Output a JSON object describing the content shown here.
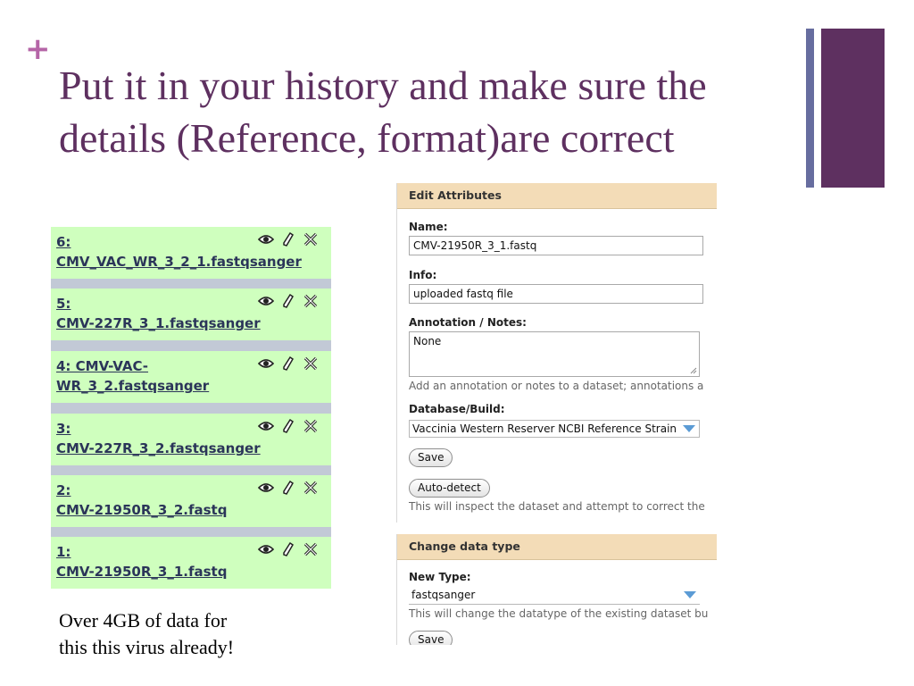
{
  "slide": {
    "plus": "+",
    "title": "Put it in your history and make sure the details (Reference, format)are correct",
    "note_line1": "Over 4GB of data for",
    "note_line2": "this this virus already!"
  },
  "history": {
    "items": [
      {
        "line1": "6:",
        "line2": "CMV_VAC_WR_3_2_1.fastqsanger"
      },
      {
        "line1": "5:",
        "line2": "CMV-227R_3_1.fastqsanger"
      },
      {
        "line1": "4: CMV-VAC-",
        "line2": "WR_3_2.fastqsanger"
      },
      {
        "line1": "3:",
        "line2": "CMV-227R_3_2.fastqsanger"
      },
      {
        "line1": "2:",
        "line2": "CMV-21950R_3_2.fastq"
      },
      {
        "line1": "1:",
        "line2": "CMV-21950R_3_1.fastq"
      }
    ],
    "icons": [
      "eye-icon",
      "pencil-icon",
      "delete-x-icon"
    ]
  },
  "edit_attributes": {
    "title": "Edit Attributes",
    "name_label": "Name:",
    "name_value": "CMV-21950R_3_1.fastq",
    "info_label": "Info:",
    "info_value": "uploaded fastq file",
    "annotation_label": "Annotation / Notes:",
    "annotation_value": "None",
    "annotation_help": "Add an annotation or notes to a dataset; annotations a",
    "db_label": "Database/Build:",
    "db_value": "Vaccinia Western Reserver NCBI Reference Strain",
    "save_label": "Save",
    "autodetect_label": "Auto-detect",
    "autodetect_help": "This will inspect the dataset and attempt to correct the"
  },
  "change_type": {
    "title": "Change data type",
    "new_type_label": "New Type:",
    "new_type_value": "fastqsanger",
    "help": "This will change the datatype of the existing dataset bu",
    "save_label": "Save"
  },
  "colors": {
    "title": "#5e3060",
    "accent_plus": "#b565a7",
    "history_item_bg": "#cfffbe",
    "panel_header_bg": "#f3dcb7"
  }
}
